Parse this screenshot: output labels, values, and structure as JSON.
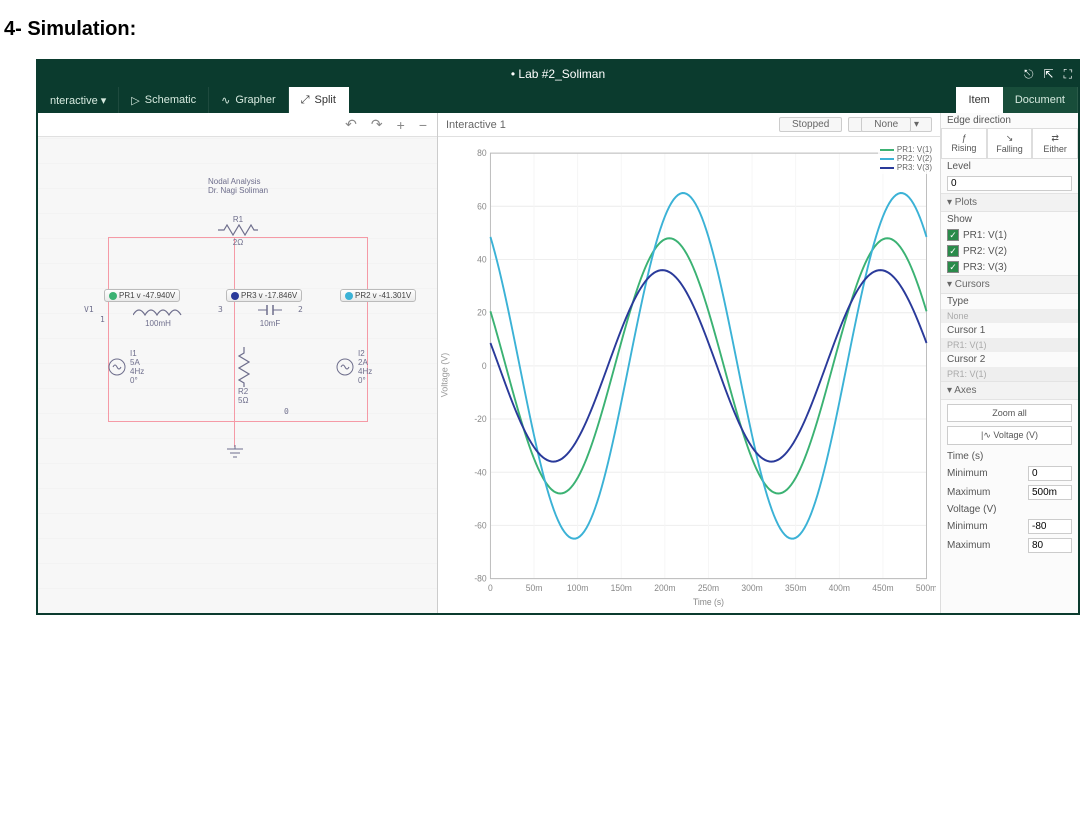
{
  "doc": {
    "heading": "4- Simulation:"
  },
  "titlebar": {
    "title": "• Lab #2_Soliman"
  },
  "toolbar": {
    "left": [
      {
        "label": "nteractive ▾",
        "icon": ""
      },
      {
        "label": "Schematic",
        "icon": "▷"
      },
      {
        "label": "Grapher",
        "icon": "∿"
      },
      {
        "label": "Split",
        "icon": "⤢",
        "active": true
      }
    ],
    "right": [
      {
        "label": "Item",
        "active": true
      },
      {
        "label": "Document"
      }
    ]
  },
  "editbar": {
    "undo": "↶",
    "redo": "↷",
    "plus": "+",
    "minus": "−"
  },
  "schematic": {
    "heading1": "Nodal Analysis",
    "heading2": "Dr. Nagi Soliman",
    "r1_name": "R1",
    "r1_val": "2Ω",
    "r2_name": "R2",
    "r2_val": "5Ω",
    "l1_name": "100mH",
    "c1_name": "10mF",
    "v1": "V1",
    "node_1": "1",
    "node_2": "2",
    "node_3": "3",
    "node_0": "0",
    "i1_name": "I1",
    "i1_a": "5A",
    "i1_hz": "4Hz",
    "i1_ph": "0°",
    "i2_name": "I2",
    "i2_a": "2A",
    "i2_hz": "4Hz",
    "i2_ph": "0°",
    "pr1": {
      "name": "PR1",
      "val": "v -47.940V"
    },
    "pr2": {
      "name": "PR2",
      "val": "v -41.301V"
    },
    "pr3": {
      "name": "PR3",
      "val": "v -17.846V"
    }
  },
  "graph": {
    "title": "Interactive 1",
    "status": "Stopped",
    "mode": "None",
    "xlabel": "Time (s)",
    "ylabel": "Voltage (V)",
    "legend": [
      {
        "name": "PR1: V(1)",
        "color": "#3bb273"
      },
      {
        "name": "PR2: V(2)",
        "color": "#3bb2d6"
      },
      {
        "name": "PR3: V(3)",
        "color": "#2a3a9a"
      }
    ]
  },
  "chart_data": {
    "type": "line",
    "title": "Interactive 1",
    "xlabel": "Time (s)",
    "ylabel": "Voltage (V)",
    "xlim": [
      0,
      0.5
    ],
    "ylim": [
      -80,
      80
    ],
    "x_ticks": [
      "0",
      "50m",
      "100m",
      "150m",
      "200m",
      "250m",
      "300m",
      "350m",
      "400m",
      "450m",
      "500m"
    ],
    "y_ticks": [
      -80,
      -60,
      -40,
      -20,
      0,
      20,
      40,
      60,
      80
    ],
    "series": [
      {
        "name": "PR1: V(1)",
        "color": "#3bb273",
        "amp": 48,
        "freq": 4,
        "phase": 2.7
      },
      {
        "name": "PR2: V(2)",
        "color": "#3bb2d6",
        "amp": 65,
        "freq": 4,
        "phase": 2.3
      },
      {
        "name": "PR3: V(3)",
        "color": "#2a3a9a",
        "amp": 36,
        "freq": 4,
        "phase": 2.9
      }
    ]
  },
  "panel": {
    "edge_direction": "Edge direction",
    "edge_btns": [
      "Rising",
      "Falling",
      "Either"
    ],
    "level_label": "Level",
    "level_val": "0",
    "plots_label": "▾ Plots",
    "show_label": "Show",
    "plot_checks": [
      "PR1: V(1)",
      "PR2: V(2)",
      "PR3: V(3)"
    ],
    "cursors_label": "▾ Cursors",
    "type_label": "Type",
    "type_val": "None",
    "cursor1_label": "Cursor 1",
    "cursor1_val": "PR1: V(1)",
    "cursor2_label": "Cursor 2",
    "cursor2_val": "PR1: V(1)",
    "axes_label": "▾ Axes",
    "zoom_all": "Zoom all",
    "axis_v_btn": "|∿  Voltage (V)",
    "time_label": "Time (s)",
    "min_label": "Minimum",
    "time_min_val": "0",
    "max_label": "Maximum",
    "time_max_val": "500m",
    "voltage_label": "Voltage (V)",
    "v_min_val": "-80",
    "v_max_val": "80"
  }
}
